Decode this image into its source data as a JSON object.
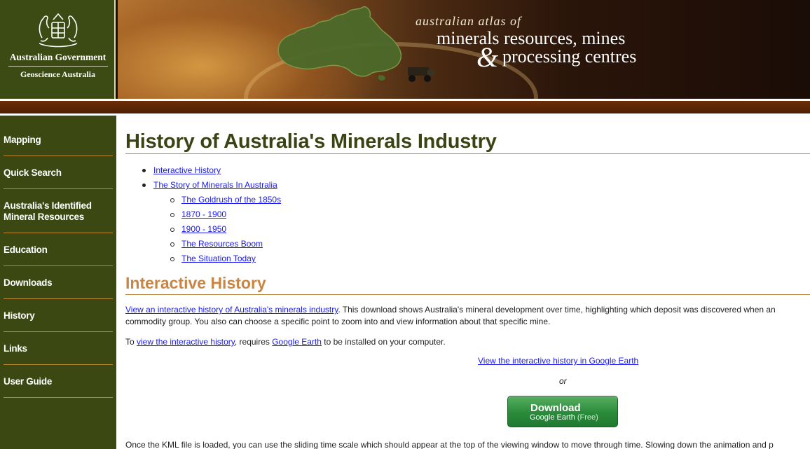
{
  "header": {
    "gov_name": "Australian Government",
    "gov_agency": "Geoscience Australia",
    "atlas_line1": "australian atlas of",
    "atlas_line2": "minerals resources, mines",
    "atlas_amp": "&",
    "atlas_line3": "processing centres"
  },
  "sidebar": {
    "items": [
      {
        "label": "Mapping"
      },
      {
        "label": "Quick Search"
      },
      {
        "label": "Australia's Identified Mineral Resources"
      },
      {
        "label": "Education"
      },
      {
        "label": "Downloads"
      },
      {
        "label": "History"
      },
      {
        "label": "Links"
      },
      {
        "label": "User Guide"
      }
    ]
  },
  "main": {
    "title": "History of Australia's Minerals Industry",
    "toc": [
      {
        "label": "Interactive History"
      },
      {
        "label": "The Story of Minerals In Australia"
      },
      {
        "label": "The Goldrush of the 1850s"
      },
      {
        "label": "1870 - 1900"
      },
      {
        "label": "1900 - 1950"
      },
      {
        "label": "The Resources Boom"
      },
      {
        "label": "The Situation Today"
      }
    ],
    "section_title": "Interactive History",
    "para1_link": "View an interactive history of Australia's minerals industry",
    "para1_text_a": ". This download shows Australia's mineral development over time, highlighting which deposit was discovered when an",
    "para1_text_b": "commodity group. You also can choose a specific point to zoom into and view information about that specific mine.",
    "para2_prefix": "To ",
    "para2_link1": "view the interactive history",
    "para2_mid": ", requires ",
    "para2_link2": "Google Earth",
    "para2_suffix": " to be installed on your computer.",
    "ge_link": "View the interactive history in Google Earth",
    "or_text": "or",
    "download_label": "Download",
    "download_sub": "Google Earth",
    "download_free": "(Free)",
    "para3": "Once the KML file is loaded, you can use the sliding time scale which should appear at the top of the viewing window to move through time. Slowing down the animation and p"
  },
  "colors": {
    "sidebar_bg": "#3b4811",
    "title_green": "#3a4314",
    "section_orange": "#c98543",
    "link_blue": "#1a1aee",
    "stripe_brown": "#5a2606",
    "button_green": "#2a8a3b"
  }
}
